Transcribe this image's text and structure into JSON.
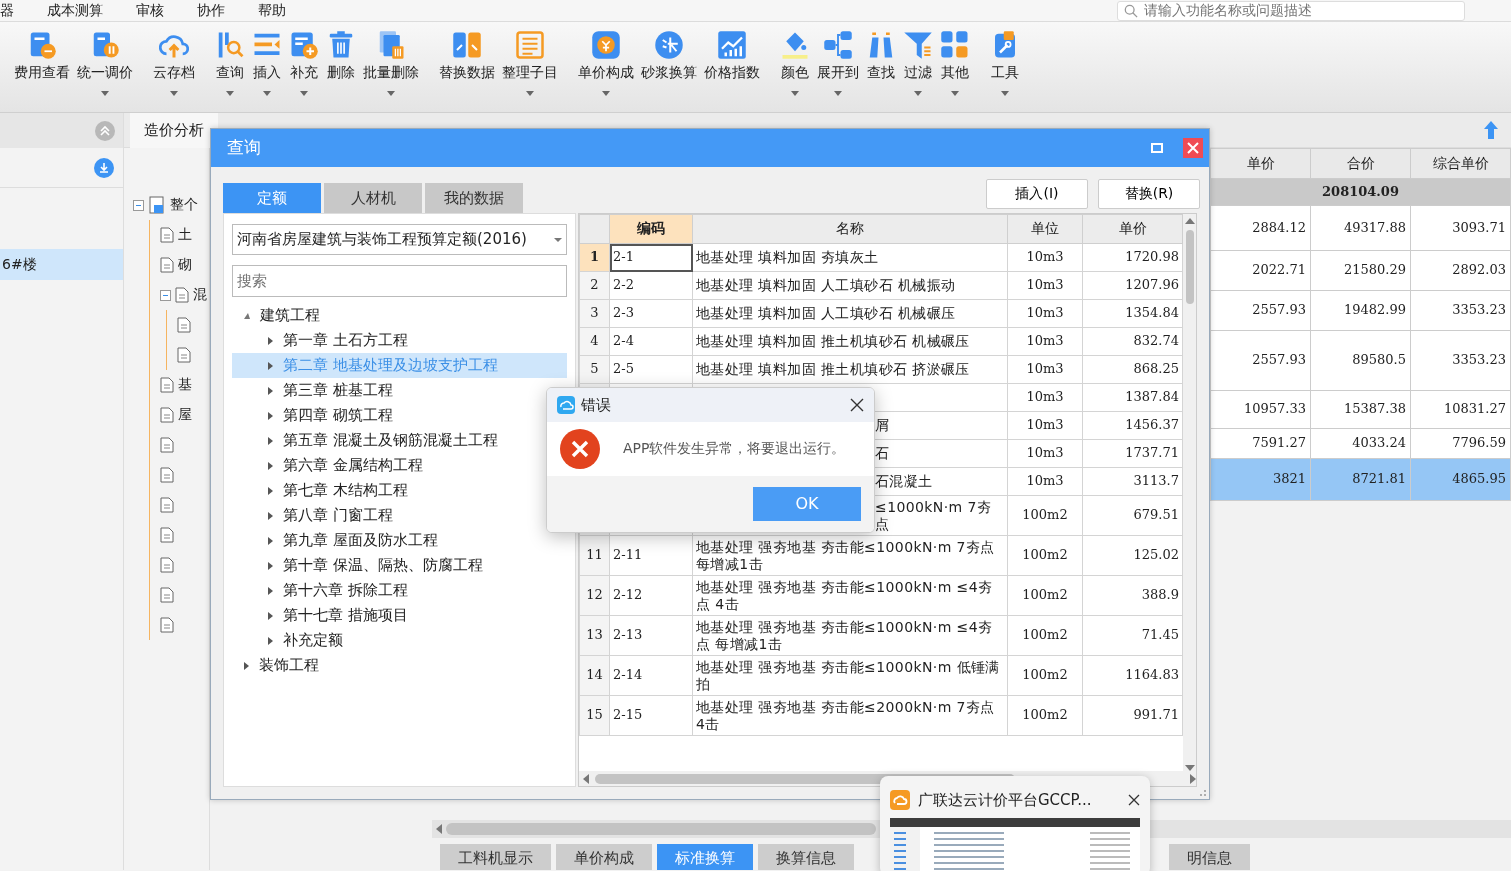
{
  "menu_bar": {
    "items": [
      "器",
      "成本测算",
      "审核",
      "协作",
      "帮助"
    ],
    "search": {
      "placeholder": "请输入功能名称或问题描述"
    }
  },
  "toolbar": {
    "groups": [
      [
        {
          "label": "费用查看",
          "dropdown": false
        },
        {
          "label": "统一调价",
          "dropdown": true
        }
      ],
      [
        {
          "label": "云存档",
          "dropdown": true
        }
      ],
      [
        {
          "label": "查询",
          "dropdown": true
        },
        {
          "label": "插入",
          "dropdown": true
        },
        {
          "label": "补充",
          "dropdown": true
        },
        {
          "label": "删除",
          "dropdown": false
        },
        {
          "label": "批量删除",
          "dropdown": true
        }
      ],
      [
        {
          "label": "替换数据",
          "dropdown": false
        },
        {
          "label": "整理子目",
          "dropdown": true
        }
      ],
      [
        {
          "label": "单价构成",
          "dropdown": true
        },
        {
          "label": "砂浆换算",
          "dropdown": false
        },
        {
          "label": "价格指数",
          "dropdown": false
        }
      ],
      [
        {
          "label": "颜色",
          "dropdown": true
        },
        {
          "label": "展开到",
          "dropdown": true
        },
        {
          "label": "查找",
          "dropdown": false
        },
        {
          "label": "过滤",
          "dropdown": true
        },
        {
          "label": "其他",
          "dropdown": true
        }
      ],
      [
        {
          "label": "工具",
          "dropdown": true
        }
      ]
    ]
  },
  "side_panel": {
    "items": [
      {
        "label": "6#楼",
        "selected": true
      }
    ]
  },
  "work_tabs": [
    {
      "label": "造价分析"
    }
  ],
  "project_tree": [
    {
      "kind": "estimate",
      "label": "整个",
      "expanded": true,
      "children": [
        {
          "kind": "file",
          "label": "土"
        },
        {
          "kind": "file",
          "label": "砌"
        },
        {
          "kind": "file",
          "label": "混",
          "expanded": true,
          "children": [
            {
              "kind": "file"
            },
            {
              "kind": "file"
            }
          ]
        },
        {
          "kind": "file",
          "label": "基"
        },
        {
          "kind": "file",
          "label": "屋"
        },
        {
          "kind": "file"
        },
        {
          "kind": "file"
        },
        {
          "kind": "file"
        },
        {
          "kind": "file"
        },
        {
          "kind": "file"
        },
        {
          "kind": "file"
        },
        {
          "kind": "file"
        }
      ]
    }
  ],
  "main_table": {
    "columns": [
      "单价",
      "合价",
      "综合单价"
    ],
    "summary": "208104.09",
    "rows": [
      {
        "values": [
          "2884.12",
          "49317.88",
          "3093.71"
        ],
        "selected": false
      },
      {
        "values": [
          "2022.71",
          "21580.29",
          "2892.03"
        ],
        "selected": false
      },
      {
        "values": [
          "2557.93",
          "19482.99",
          "3353.23"
        ],
        "selected": false
      },
      {
        "values": [
          "2557.93",
          "89580.5",
          "3353.23"
        ],
        "selected": false
      },
      {
        "values": [
          "10957.33",
          "15387.38",
          "10831.27"
        ],
        "selected": false
      },
      {
        "values": [
          "7591.27",
          "4033.24",
          "7796.59"
        ],
        "selected": false
      },
      {
        "values": [
          "3821",
          "8721.81",
          "4865.95"
        ],
        "selected": true
      }
    ]
  },
  "bottom_tabs": [
    {
      "label": "工料机显示",
      "selected": false
    },
    {
      "label": "单价构成",
      "selected": false
    },
    {
      "label": "标准换算",
      "selected": true
    },
    {
      "label": "换算信息",
      "selected": false
    },
    {
      "label": "明信息",
      "selected": false
    }
  ],
  "query_dialog": {
    "title": "查询",
    "tabs": [
      {
        "label": "定额",
        "selected": true
      },
      {
        "label": "人材机",
        "selected": false
      },
      {
        "label": "我的数据",
        "selected": false
      }
    ],
    "buttons": [
      "插入(I)",
      "替换(R)"
    ],
    "library": {
      "value": "河南省房屋建筑与装饰工程预算定额(2016)"
    },
    "search": {
      "placeholder": "搜索"
    },
    "tree": [
      {
        "label": "建筑工程",
        "expanded": true,
        "selected": false,
        "children": [
          {
            "label": "第一章 土石方工程",
            "expanded": false,
            "selected": false
          },
          {
            "label": "第二章 地基处理及边坡支护工程",
            "expanded": false,
            "selected": true
          },
          {
            "label": "第三章 桩基工程",
            "expanded": false,
            "selected": false
          },
          {
            "label": "第四章 砌筑工程",
            "expanded": false,
            "selected": false
          },
          {
            "label": "第五章 混凝土及钢筋混凝土工程",
            "expanded": false,
            "selected": false
          },
          {
            "label": "第六章 金属结构工程",
            "expanded": false,
            "selected": false
          },
          {
            "label": "第七章 木结构工程",
            "expanded": false,
            "selected": false
          },
          {
            "label": "第八章 门窗工程",
            "expanded": false,
            "selected": false
          },
          {
            "label": "第九章 屋面及防水工程",
            "expanded": false,
            "selected": false
          },
          {
            "label": "第十章 保温、隔热、防腐工程",
            "expanded": false,
            "selected": false
          },
          {
            "label": "第十六章 拆除工程",
            "expanded": false,
            "selected": false
          },
          {
            "label": "第十七章 措施项目",
            "expanded": false,
            "selected": false
          },
          {
            "label": "补充定额",
            "expanded": false,
            "selected": false
          }
        ]
      },
      {
        "label": "装饰工程",
        "expanded": false,
        "selected": false
      }
    ],
    "table": {
      "columns": [
        {
          "label": "编码",
          "selected": true
        },
        {
          "label": "名称",
          "selected": false
        },
        {
          "label": "单位",
          "selected": false
        },
        {
          "label": "单价",
          "selected": false
        }
      ],
      "rows": [
        {
          "num": "1",
          "code": "2-1",
          "name": "地基处理 填料加固 夯填灰土",
          "unit": "10m3",
          "price": "1720.98",
          "selected": true,
          "covered": false,
          "tall": false
        },
        {
          "num": "2",
          "code": "2-2",
          "name": "地基处理 填料加固 人工填砂石 机械振动",
          "unit": "10m3",
          "price": "1207.96",
          "selected": false,
          "covered": false,
          "tall": false
        },
        {
          "num": "3",
          "code": "2-3",
          "name": "地基处理 填料加固 人工填砂石 机械碾压",
          "unit": "10m3",
          "price": "1354.84",
          "selected": false,
          "covered": false,
          "tall": false
        },
        {
          "num": "4",
          "code": "2-4",
          "name": "地基处理 填料加固 推土机填砂石 机械碾压",
          "unit": "10m3",
          "price": "832.74",
          "selected": false,
          "covered": false,
          "tall": false
        },
        {
          "num": "5",
          "code": "2-5",
          "name": "地基处理 填料加固 推土机填砂石 挤淤碾压",
          "unit": "10m3",
          "price": "868.25",
          "selected": false,
          "covered": false,
          "tall": false
        },
        {
          "unit": "10m3",
          "price": "1387.84",
          "selected": false,
          "covered": true,
          "tall": false
        },
        {
          "name": "屑",
          "unit": "10m3",
          "price": "1456.37",
          "selected": false,
          "covered": true,
          "tall": false
        },
        {
          "name": "石",
          "unit": "10m3",
          "price": "1737.71",
          "selected": false,
          "covered": true,
          "tall": false
        },
        {
          "name": "石混凝土",
          "unit": "10m3",
          "price": "3113.7",
          "selected": false,
          "covered": true,
          "tall": false
        },
        {
          "name": "≤1000kN·m 7夯点",
          "unit": "100m2",
          "price": "679.51",
          "selected": false,
          "covered": true,
          "tall": true
        },
        {
          "num": "11",
          "code": "2-11",
          "name": "地基处理 强夯地基 夯击能≤1000kN·m 7夯点每增减1击",
          "unit": "100m2",
          "price": "125.02",
          "selected": false,
          "covered": false,
          "tall": true
        },
        {
          "num": "12",
          "code": "2-12",
          "name": "地基处理 强夯地基 夯击能≤1000kN·m ≤4夯点 4击",
          "unit": "100m2",
          "price": "388.9",
          "selected": false,
          "covered": false,
          "tall": true
        },
        {
          "num": "13",
          "code": "2-13",
          "name": "地基处理 强夯地基 夯击能≤1000kN·m ≤4夯点 每增减1击",
          "unit": "100m2",
          "price": "71.45",
          "selected": false,
          "covered": false,
          "tall": true
        },
        {
          "num": "14",
          "code": "2-14",
          "name": "地基处理 强夯地基 夯击能≤1000kN·m 低锤满拍",
          "unit": "100m2",
          "price": "1164.83",
          "selected": false,
          "covered": false,
          "tall": true
        },
        {
          "num": "15",
          "code": "2-15",
          "name": "地基处理 强夯地基 夯击能≤2000kN·m 7夯点 4击",
          "unit": "100m2",
          "price": "991.71",
          "selected": false,
          "covered": false,
          "tall": true
        }
      ]
    }
  },
  "error_dialog": {
    "title": "错误",
    "message": "APP软件发生异常，将要退出运行。",
    "button": "OK"
  },
  "taskbar_preview": {
    "title": "广联达云计价平台GCCP..."
  }
}
